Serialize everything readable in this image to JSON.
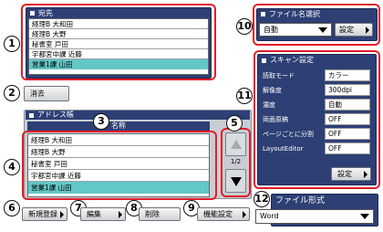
{
  "destination": {
    "header": "宛先",
    "items": [
      "経理B 大和田",
      "経理B 大野",
      "秘書室 戸田",
      "宇都宮中課 近藤",
      "営業1課 山田"
    ],
    "selected_index": 4
  },
  "clear_button": "消去",
  "address_book": {
    "header": "アドレス帳",
    "column_header": "名称",
    "items": [
      "経理B 大和田",
      "経理B 大野",
      "秘書室 戸田",
      "宇都宮中課 近藤",
      "営業1課 山田"
    ],
    "selected_index": 4,
    "page_indicator": "1/2"
  },
  "buttons": {
    "new_register": "新規登録",
    "edit": "編集",
    "delete": "削除",
    "settings": "機能設定"
  },
  "file_name": {
    "header": "ファイル名選択",
    "value": "自動",
    "settings_button": "設定"
  },
  "scan_settings": {
    "header": "スキャン設定",
    "rows": [
      {
        "label": "読取モード",
        "value": "カラー"
      },
      {
        "label": "解像度",
        "value": "300dpi"
      },
      {
        "label": "濃度",
        "value": "自動"
      },
      {
        "label": "両面原稿",
        "value": "OFF"
      },
      {
        "label": "ページごとに分割",
        "value": "OFF"
      },
      {
        "label": "LayoutEditor",
        "value": "OFF"
      }
    ],
    "settings_button": "設定"
  },
  "file_format": {
    "header": "ファイル形式",
    "value": "Word"
  },
  "callouts": [
    "1",
    "2",
    "3",
    "4",
    "5",
    "6",
    "7",
    "8",
    "9",
    "10",
    "11",
    "12"
  ],
  "colors": {
    "panel_blue": "#2d3f74",
    "highlight": "#e11d2a",
    "selected_row": "#63c7c5"
  }
}
